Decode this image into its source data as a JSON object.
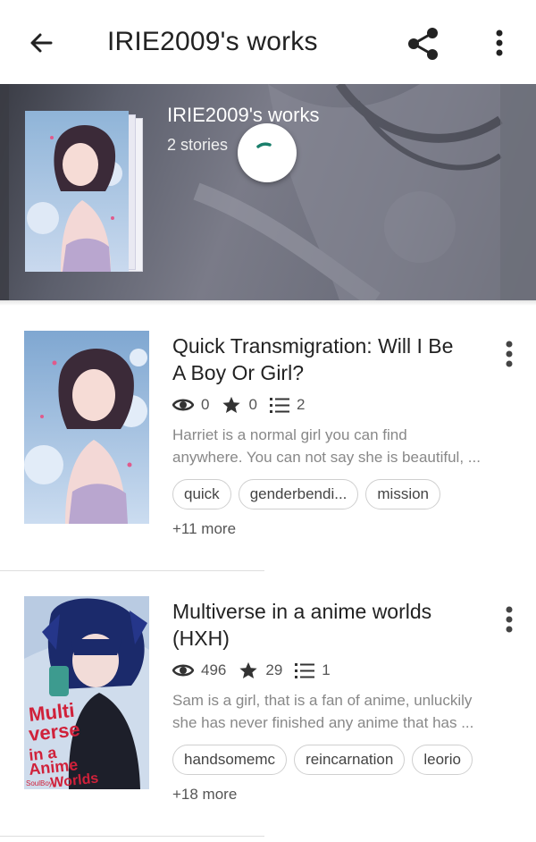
{
  "appbar": {
    "title": "IRIE2009's works",
    "back_icon": "arrow-left-icon",
    "share_icon": "share-icon",
    "more_icon": "more-vert-icon"
  },
  "header": {
    "title": "IRIE2009's works",
    "subtitle": "2 stories",
    "loading_icon": "loading-spinner-icon"
  },
  "stories": [
    {
      "title_line1": "Quick Transmigration: Will I Be",
      "title_line2": "A Boy Or Girl?",
      "reads": "0",
      "votes": "0",
      "parts": "2",
      "desc_line1": "Harriet is a normal girl you can find",
      "desc_line2": "anywhere. You can not say she is beautiful, ...",
      "tags": [
        "quick",
        "genderbendi...",
        "mission"
      ],
      "more_tags": "+11 more"
    },
    {
      "title_line1": "Multiverse in a anime worlds",
      "title_line2": "(HXH)",
      "reads": "496",
      "votes": "29",
      "parts": "1",
      "desc_line1": "Sam is a girl, that is a fan of anime, unluckily",
      "desc_line2": "she has never finished any anime that has ...",
      "tags": [
        "handsomemc",
        "reincarnation",
        "leorio"
      ],
      "more_tags": "+18 more",
      "cover_text": "Multiverse in a Anime Worlds",
      "cover_sig": "SoulBoy"
    }
  ],
  "colors": {
    "text": "#222222",
    "muted": "#888888",
    "accent_spinner": "#1a7f6b",
    "cover2_text": "#d0213a"
  }
}
